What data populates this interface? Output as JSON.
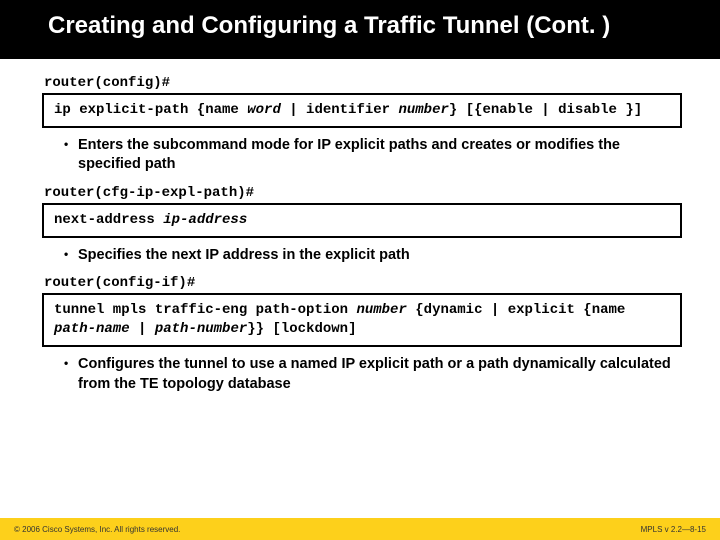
{
  "title": "Creating and Configuring a Traffic Tunnel (Cont. )",
  "block1": {
    "prompt": "router(config)#",
    "cmd_p1": "ip explicit-path {name ",
    "cmd_v1": "word",
    "cmd_p2": " | identifier ",
    "cmd_v2": "number",
    "cmd_p3": "} [{enable | disable }]",
    "bullet": "Enters the subcommand mode for IP explicit paths and creates or modifies the specified path"
  },
  "block2": {
    "prompt": "router(cfg-ip-expl-path)#",
    "cmd_p1": "next-address ",
    "cmd_v1": "ip-address",
    "bullet": "Specifies the next IP address in the explicit path"
  },
  "block3": {
    "prompt": "router(config-if)#",
    "cmd_p1": "tunnel mpls traffic-eng path-option ",
    "cmd_v1": "number",
    "cmd_p2": " {dynamic | explicit {name ",
    "cmd_v2": "path-name",
    "cmd_p3": " | ",
    "cmd_v3": "path-number",
    "cmd_p4": "}} [lockdown]",
    "bullet": "Configures the tunnel to use a named IP explicit path or a path dynamically calculated from the TE topology database"
  },
  "footer": {
    "left": "© 2006 Cisco Systems, Inc. All rights reserved.",
    "right": "MPLS v 2.2—8-15"
  }
}
